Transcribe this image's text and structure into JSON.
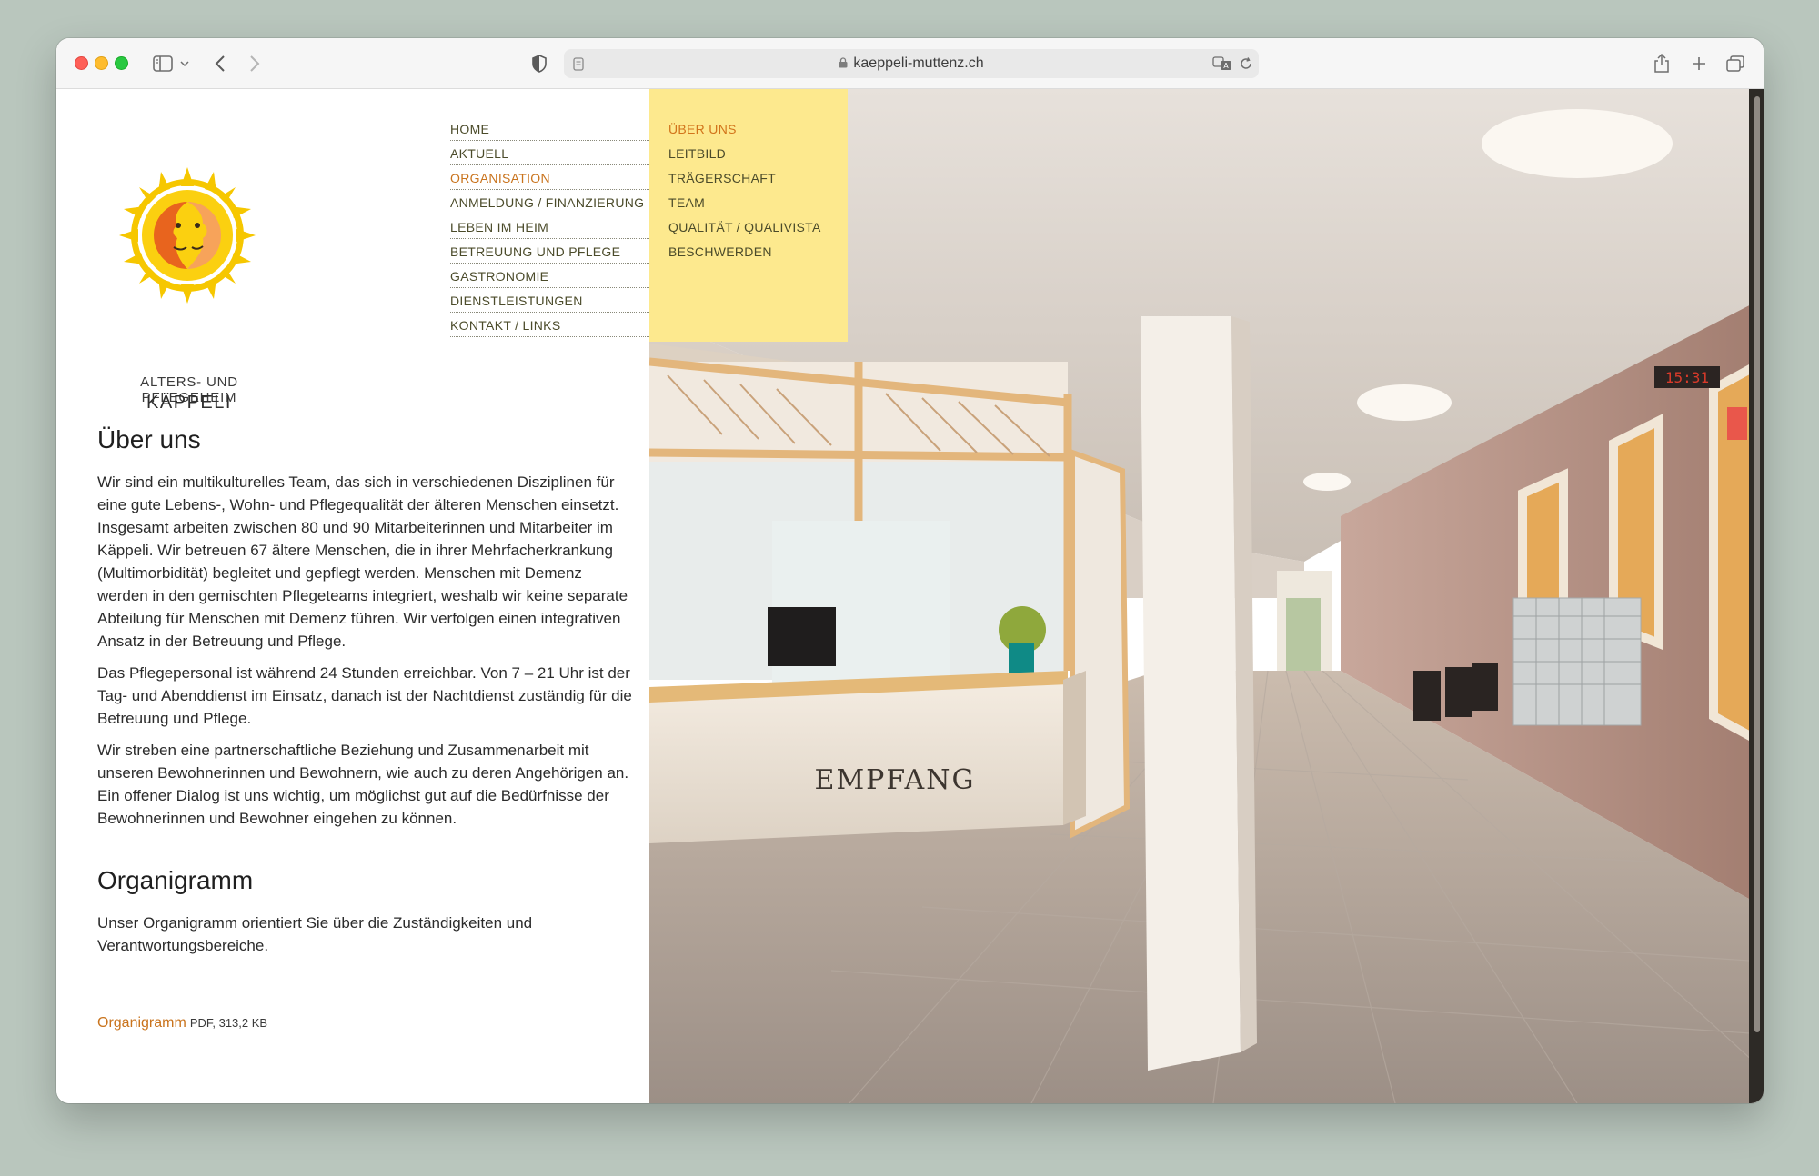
{
  "browser": {
    "url": "kaeppeli-muttenz.ch"
  },
  "logo": {
    "line1": "ALTERS- UND PFLEGEHEIM",
    "line2": "KÄPPELI"
  },
  "main_nav": [
    {
      "label": "HOME",
      "active": false
    },
    {
      "label": "AKTUELL",
      "active": false
    },
    {
      "label": "ORGANISATION",
      "active": true
    },
    {
      "label": "ANMELDUNG / FINANZIERUNG",
      "active": false
    },
    {
      "label": "LEBEN IM HEIM",
      "active": false
    },
    {
      "label": "BETREUUNG UND PFLEGE",
      "active": false
    },
    {
      "label": "GASTRONOMIE",
      "active": false
    },
    {
      "label": "DIENSTLEISTUNGEN",
      "active": false
    },
    {
      "label": "KONTAKT / LINKS",
      "active": false
    }
  ],
  "sub_nav": [
    {
      "label": "ÜBER UNS",
      "active": true
    },
    {
      "label": "LEITBILD",
      "active": false
    },
    {
      "label": "TRÄGERSCHAFT",
      "active": false
    },
    {
      "label": "TEAM",
      "active": false
    },
    {
      "label": "QUALITÄT / QUALIVISTA",
      "active": false
    },
    {
      "label": "BESCHWERDEN",
      "active": false
    }
  ],
  "content": {
    "heading1": "Über uns",
    "paragraphs": [
      "Wir sind ein multikulturelles Team, das sich in verschiedenen Disziplinen für eine gute Lebens-, Wohn- und Pflegequalität der älteren Menschen einsetzt. Insgesamt arbeiten zwischen 80 und 90 Mitarbeiterinnen und Mitarbeiter im Käppeli. Wir betreuen 67 ältere Menschen, die in ihrer Mehrfacherkrankung (Multimorbidität) begleitet und gepflegt werden. Menschen mit Demenz werden in den gemischten Pflegeteams integriert, weshalb wir keine separate Abteilung für Menschen mit Demenz führen. Wir verfolgen einen integrativen Ansatz in der Betreuung und Pflege.",
      "Das Pflegepersonal ist während 24 Stunden erreichbar. Von 7 – 21 Uhr ist der Tag- und Abenddienst im Einsatz, danach ist der Nachtdienst zuständig für die Betreuung und Pflege.",
      "Wir streben eine partnerschaftliche Beziehung und Zusammenarbeit mit unseren Bewohnerinnen und Bewohnern, wie auch zu deren Angehörigen an. Ein offener Dialog ist uns wichtig, um möglichst gut auf die Bedürfnisse der Bewohnerinnen und Bewohner eingehen zu können."
    ],
    "heading2": "Organigramm",
    "organigramm_text": "Unser Organigramm orientiert Sie über die Zuständigkeiten und Verantwortungsbereiche.",
    "pdf_link": "Organigramm",
    "pdf_meta": "PDF, 313,2 KB"
  },
  "photo": {
    "sign": "EMPFANG",
    "clock": "15:31"
  },
  "colors": {
    "accent_orange": "#c9731c",
    "subnav_yellow": "#fde98e",
    "nav_text": "#4b4b2a"
  }
}
